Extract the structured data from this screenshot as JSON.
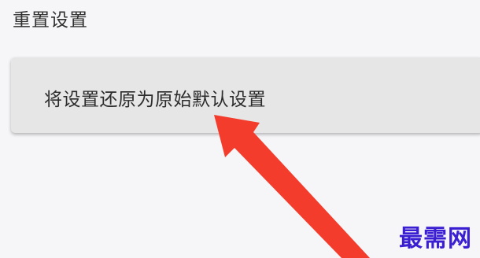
{
  "header": {
    "title": "重置设置"
  },
  "reset_option": {
    "label": "将设置还原为原始默认设置"
  },
  "watermark": {
    "text": "最需网",
    "color": "#3a1ed2"
  },
  "annotation": {
    "icon": "arrow-icon",
    "color": "#f33c2c"
  },
  "colors": {
    "background": "#f6f6f8",
    "card": "#e6e6e6"
  }
}
